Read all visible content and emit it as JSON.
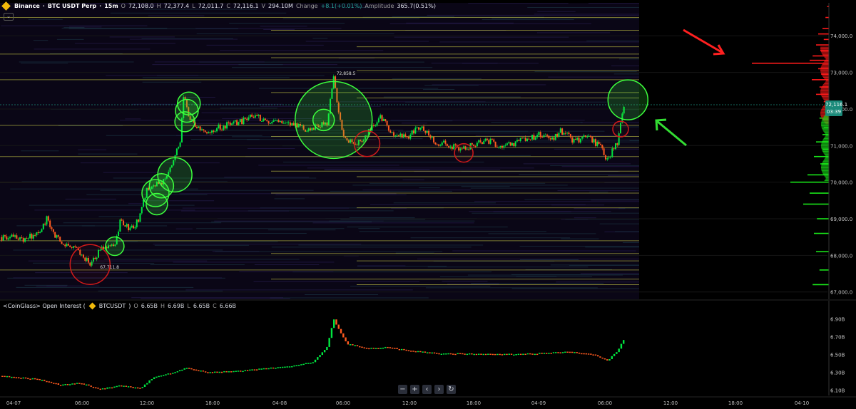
{
  "header": {
    "exchange": "Binance",
    "symbol": "BTC USDT Perp",
    "interval": "15m",
    "open_label": "O",
    "open": "72,108.0",
    "high_label": "H",
    "high": "72,377.4",
    "low_label": "L",
    "low": "72,011.7",
    "close_label": "C",
    "close": "72,116.1",
    "volume_label": "V",
    "volume": "294.10M",
    "change_label": "Change",
    "change": "+8.1(+0.01%)",
    "amplitude_label": "Amplitude",
    "amplitude": "365.7(0.51%)"
  },
  "oi_header": {
    "name": "<CoinGlass> Open Interest (",
    "symbol": "BTCUSDT",
    "close_paren": ")",
    "open": "6.65B",
    "high": "6.69B",
    "low": "6.65B",
    "close": "6.66B"
  },
  "price_badge": {
    "price": "72,116.1",
    "countdown": "03:39"
  },
  "annotations": {
    "high_marker": "72,858.5",
    "low_marker": "67,711.8"
  },
  "nav_buttons": {
    "zoom_out": "−",
    "zoom_in": "+",
    "prev": "‹",
    "next": "›",
    "reset": "↻"
  },
  "colors": {
    "up": "#00e640",
    "down": "#ff5a1f",
    "ask_bar": "#ff1a1a",
    "bid_bar": "#19e619",
    "heat_line": "#d8d84a",
    "circle_buy": "#3dff3d",
    "circle_sell": "#d11a1a",
    "arrow_red": "#ff2020",
    "arrow_green": "#33dd33"
  },
  "chart_data": [
    {
      "type": "candlestick",
      "title": "Binance · BTC USDT Perp · 15m",
      "price_axis_ticks": [
        "74,000.0",
        "73,000.0",
        "72,000.0",
        "71,000.0",
        "70,000.0",
        "69,000.0",
        "68,000.0",
        "67,000.0"
      ],
      "ylim": [
        66800,
        74900
      ],
      "time_axis_ticks": [
        "04-07",
        "06:00",
        "12:00",
        "18:00",
        "04-08",
        "06:00",
        "12:00",
        "18:00",
        "04-09",
        "06:00",
        "12:00",
        "18:00",
        "04-10"
      ],
      "close_path": [
        {
          "t": 0,
          "price": 68500
        },
        {
          "t": 4,
          "price": 68450
        },
        {
          "t": 6,
          "price": 68650
        },
        {
          "t": 7,
          "price": 69000
        },
        {
          "t": 8,
          "price": 68550
        },
        {
          "t": 9.5,
          "price": 68300
        },
        {
          "t": 11,
          "price": 68250
        },
        {
          "t": 12.5,
          "price": 68000
        },
        {
          "t": 13.5,
          "price": 67750
        },
        {
          "t": 15.5,
          "price": 68250
        },
        {
          "t": 17,
          "price": 68200
        },
        {
          "t": 18,
          "price": 68900
        },
        {
          "t": 20,
          "price": 68700
        },
        {
          "t": 21,
          "price": 69100
        },
        {
          "t": 22,
          "price": 69800
        },
        {
          "t": 23,
          "price": 69900
        },
        {
          "t": 24,
          "price": 69950
        },
        {
          "t": 25,
          "price": 70200
        },
        {
          "t": 26,
          "price": 70600
        },
        {
          "t": 27,
          "price": 71100
        },
        {
          "t": 27.6,
          "price": 72500
        },
        {
          "t": 28.2,
          "price": 71800
        },
        {
          "t": 29,
          "price": 71600
        },
        {
          "t": 31,
          "price": 71400
        },
        {
          "t": 33,
          "price": 71500
        },
        {
          "t": 36,
          "price": 71650
        },
        {
          "t": 38,
          "price": 71800
        },
        {
          "t": 40,
          "price": 71700
        },
        {
          "t": 42,
          "price": 71650
        },
        {
          "t": 44,
          "price": 71600
        },
        {
          "t": 46,
          "price": 71400
        },
        {
          "t": 48,
          "price": 71550
        },
        {
          "t": 49,
          "price": 71600
        },
        {
          "t": 50,
          "price": 72850
        },
        {
          "t": 50.8,
          "price": 71750
        },
        {
          "t": 51.5,
          "price": 71300
        },
        {
          "t": 53,
          "price": 71000
        },
        {
          "t": 55,
          "price": 71300
        },
        {
          "t": 57,
          "price": 71800
        },
        {
          "t": 59,
          "price": 71300
        },
        {
          "t": 61,
          "price": 71200
        },
        {
          "t": 63,
          "price": 71550
        },
        {
          "t": 65,
          "price": 71100
        },
        {
          "t": 67,
          "price": 71050
        },
        {
          "t": 69,
          "price": 70850
        },
        {
          "t": 71,
          "price": 71050
        },
        {
          "t": 73,
          "price": 71150
        },
        {
          "t": 75,
          "price": 71000
        },
        {
          "t": 77,
          "price": 71050
        },
        {
          "t": 79,
          "price": 71200
        },
        {
          "t": 81,
          "price": 71300
        },
        {
          "t": 83,
          "price": 71200
        },
        {
          "t": 84,
          "price": 71400
        },
        {
          "t": 85,
          "price": 71300
        },
        {
          "t": 86,
          "price": 71100
        },
        {
          "t": 88,
          "price": 71250
        },
        {
          "t": 90,
          "price": 70950
        },
        {
          "t": 91,
          "price": 70600
        },
        {
          "t": 92.5,
          "price": 71100
        },
        {
          "t": 93.5,
          "price": 72116
        }
      ],
      "bubbles": [
        {
          "side": "buy",
          "t": 50,
          "price": 71700,
          "size": 54
        },
        {
          "side": "buy",
          "t": 48.5,
          "price": 71700,
          "size": 15
        },
        {
          "side": "buy",
          "t": 28,
          "price": 71950,
          "size": 16
        },
        {
          "side": "buy",
          "t": 27.7,
          "price": 71650,
          "size": 14
        },
        {
          "side": "buy",
          "t": 28.3,
          "price": 72150,
          "size": 16
        },
        {
          "side": "buy",
          "t": 26.2,
          "price": 70200,
          "size": 24
        },
        {
          "side": "buy",
          "t": 24.2,
          "price": 69900,
          "size": 17
        },
        {
          "side": "buy",
          "t": 23.3,
          "price": 69700,
          "size": 19
        },
        {
          "side": "buy",
          "t": 23.5,
          "price": 69400,
          "size": 15
        },
        {
          "side": "buy",
          "t": 17.2,
          "price": 68250,
          "size": 13
        },
        {
          "side": "buy",
          "t": 94.1,
          "price": 72250,
          "size": 28
        },
        {
          "side": "sell",
          "t": 13.5,
          "price": 67750,
          "size": 28
        },
        {
          "side": "sell",
          "t": 55,
          "price": 71050,
          "size": 18
        },
        {
          "side": "sell",
          "t": 69.5,
          "price": 70800,
          "size": 13
        },
        {
          "side": "sell",
          "t": 93,
          "price": 71450,
          "size": 11
        }
      ],
      "liquidity_levels": [
        {
          "price": 74500
        },
        {
          "price": 74150
        },
        {
          "price": 73700
        },
        {
          "price": 73500
        },
        {
          "price": 73400
        },
        {
          "price": 73050
        },
        {
          "price": 72800
        },
        {
          "price": 72450
        },
        {
          "price": 72300
        },
        {
          "price": 71550
        },
        {
          "price": 71250
        },
        {
          "price": 70950
        },
        {
          "price": 70700
        },
        {
          "price": 70300
        },
        {
          "price": 70150
        },
        {
          "price": 70000
        },
        {
          "price": 69700
        },
        {
          "price": 69300
        },
        {
          "price": 68400
        },
        {
          "price": 68050
        },
        {
          "price": 67850
        },
        {
          "price": 67600
        },
        {
          "price": 67350
        },
        {
          "price": 67200
        }
      ],
      "order_book_asks": [
        {
          "price": 74800,
          "size": 4
        },
        {
          "price": 74500,
          "size": 8
        },
        {
          "price": 74200,
          "size": 15
        },
        {
          "price": 74050,
          "size": 25
        },
        {
          "price": 73900,
          "size": 12
        },
        {
          "price": 73750,
          "size": 30
        },
        {
          "price": 73600,
          "size": 20
        },
        {
          "price": 73450,
          "size": 38
        },
        {
          "price": 73330,
          "size": 45
        },
        {
          "price": 73250,
          "size": 180
        },
        {
          "price": 73100,
          "size": 25
        },
        {
          "price": 72950,
          "size": 18
        },
        {
          "price": 72800,
          "size": 40
        },
        {
          "price": 72600,
          "size": 22
        },
        {
          "price": 72400,
          "size": 30
        },
        {
          "price": 72200,
          "size": 12
        }
      ],
      "order_book_bids": [
        {
          "price": 72050,
          "size": 10
        },
        {
          "price": 71900,
          "size": 8
        },
        {
          "price": 71750,
          "size": 22
        },
        {
          "price": 71500,
          "size": 12
        },
        {
          "price": 71300,
          "size": 15
        },
        {
          "price": 71100,
          "size": 30
        },
        {
          "price": 70900,
          "size": 14
        },
        {
          "price": 70700,
          "size": 35
        },
        {
          "price": 70500,
          "size": 20
        },
        {
          "price": 70200,
          "size": 50
        },
        {
          "price": 70000,
          "size": 90
        },
        {
          "price": 69700,
          "size": 45
        },
        {
          "price": 69400,
          "size": 60
        },
        {
          "price": 69000,
          "size": 28
        },
        {
          "price": 68600,
          "size": 35
        },
        {
          "price": 68100,
          "size": 30
        },
        {
          "price": 67600,
          "size": 22
        },
        {
          "price": 67200,
          "size": 38
        }
      ]
    },
    {
      "type": "candlestick",
      "title": "<CoinGlass> Open Interest ( BTCUSDT )",
      "axis_ticks": [
        "6.90B",
        "6.70B",
        "6.50B",
        "6.30B",
        "6.10B"
      ],
      "ylim": [
        6.04,
        6.96
      ],
      "oi_path": [
        {
          "t": 0,
          "oi": 6.26
        },
        {
          "t": 6,
          "oi": 6.22
        },
        {
          "t": 9,
          "oi": 6.16
        },
        {
          "t": 12,
          "oi": 6.18
        },
        {
          "t": 15,
          "oi": 6.11
        },
        {
          "t": 18,
          "oi": 6.15
        },
        {
          "t": 21,
          "oi": 6.12
        },
        {
          "t": 23,
          "oi": 6.24
        },
        {
          "t": 26,
          "oi": 6.3
        },
        {
          "t": 28,
          "oi": 6.35
        },
        {
          "t": 31,
          "oi": 6.3
        },
        {
          "t": 35,
          "oi": 6.31
        },
        {
          "t": 39,
          "oi": 6.34
        },
        {
          "t": 44,
          "oi": 6.37
        },
        {
          "t": 47,
          "oi": 6.42
        },
        {
          "t": 49,
          "oi": 6.58
        },
        {
          "t": 50,
          "oi": 6.9
        },
        {
          "t": 51,
          "oi": 6.75
        },
        {
          "t": 52,
          "oi": 6.62
        },
        {
          "t": 55,
          "oi": 6.57
        },
        {
          "t": 58,
          "oi": 6.58
        },
        {
          "t": 62,
          "oi": 6.54
        },
        {
          "t": 66,
          "oi": 6.51
        },
        {
          "t": 70,
          "oi": 6.51
        },
        {
          "t": 75,
          "oi": 6.5
        },
        {
          "t": 80,
          "oi": 6.51
        },
        {
          "t": 85,
          "oi": 6.53
        },
        {
          "t": 89,
          "oi": 6.5
        },
        {
          "t": 91,
          "oi": 6.43
        },
        {
          "t": 92.5,
          "oi": 6.53
        },
        {
          "t": 93.5,
          "oi": 6.67
        }
      ]
    }
  ]
}
